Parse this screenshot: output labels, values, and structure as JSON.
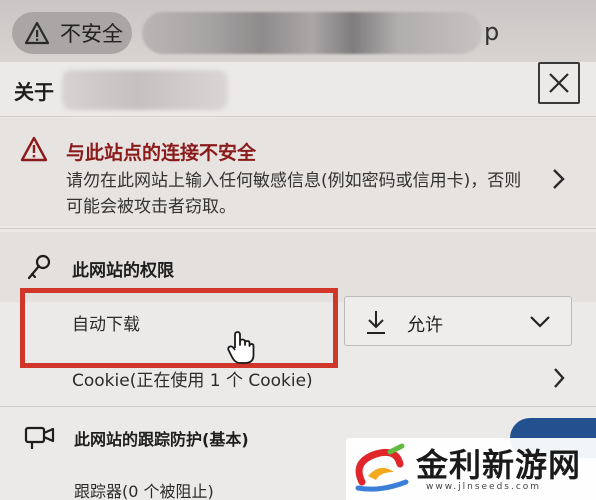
{
  "address_bar": {
    "security_label": "不安全",
    "url_tail": "p"
  },
  "panel": {
    "title_prefix": "关于",
    "warning": {
      "title": "与此站点的连接不安全",
      "body": "请勿在此网站上输入任何敏感信息(例如密码或信用卡)，否则可能会被攻击者窃取。"
    },
    "permissions": {
      "label": "此网站的权限",
      "auto_download": {
        "label": "自动下载",
        "selected": "允许"
      },
      "cookie_label": "Cookie(正在使用 1 个 Cookie)"
    },
    "tracking": {
      "label": "此网站的跟踪防护(基本)",
      "trackers": "跟踪器(0 个被阻止)"
    }
  },
  "watermark": {
    "name": "金利新游网",
    "url": "www.jlnseeds.com"
  },
  "colors": {
    "warning_red": "#8b1a1a",
    "highlight_red": "#d1362b",
    "toggle_blue": "#23518f"
  },
  "icons": [
    "warning-icon",
    "close-icon",
    "chevron-right-icon",
    "key-icon",
    "hand-cursor-icon",
    "download-icon",
    "chevron-down-icon",
    "camera-icon"
  ]
}
